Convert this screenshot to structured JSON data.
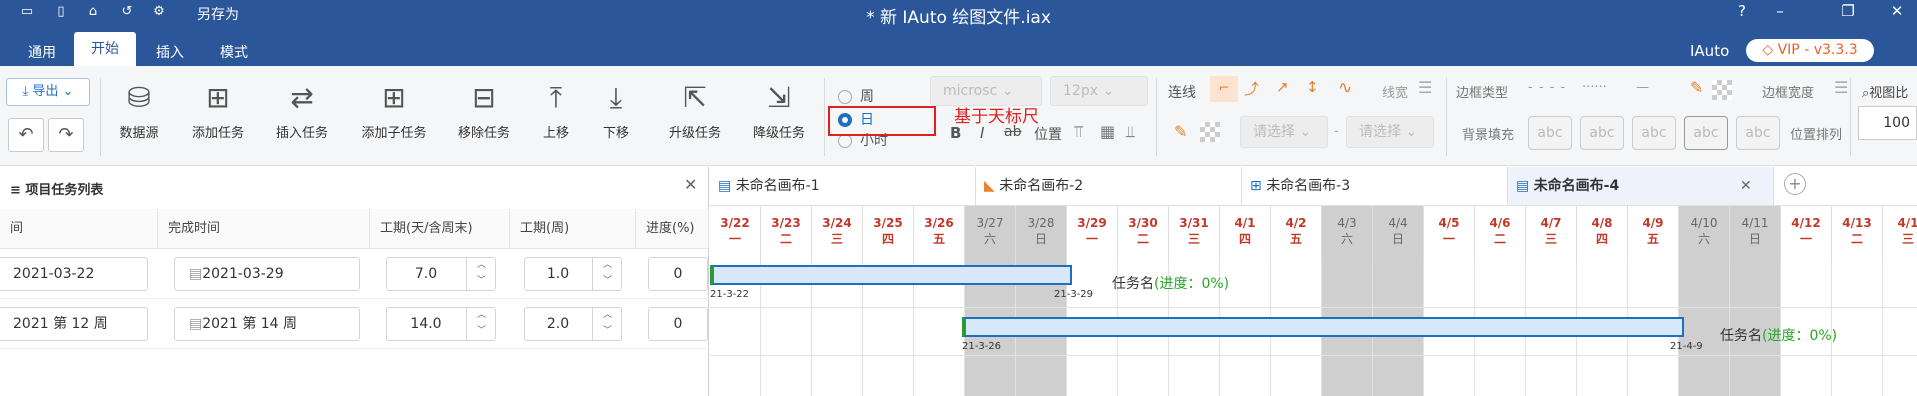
{
  "titlebar": {
    "save_as": "另存为",
    "title": "* 新 IAuto 绘图文件.iax",
    "help": "?",
    "minimize": "–",
    "restore": "❐",
    "close": "✕"
  },
  "menu": {
    "tabs": [
      "通用",
      "开始",
      "插入",
      "模式"
    ],
    "active": "开始",
    "brand": "IAuto",
    "vip": "VIP - v3.3.3"
  },
  "ribbon": {
    "export": "导出",
    "buttons": [
      "数据源",
      "添加任务",
      "插入任务",
      "添加子任务",
      "移除任务",
      "上移",
      "下移",
      "升级任务",
      "降级任务"
    ],
    "scale": {
      "week": "周",
      "day": "日",
      "hour": "小时",
      "selected": "日"
    },
    "annotation": "基于天标尺",
    "font_name": "microsc",
    "font_size": "12px",
    "format_buttons": [
      "B",
      "I",
      "ab",
      "位置"
    ],
    "line_label": "连线",
    "line_width_label": "线宽",
    "border_type_label": "边框类型",
    "border_width_label": "边框宽度",
    "view_label": "视图比",
    "zoom": "100",
    "select_placeholder": "请选择",
    "dash": "-",
    "bg_fill_label": "背景填充",
    "abc": "abc",
    "position_arrange_label": "位置排列"
  },
  "leftpanel": {
    "title": "≡ 项目任务列表",
    "columns": [
      "间",
      "完成时间",
      "工期(天/含周末)",
      "工期(周)",
      "进度(%)"
    ],
    "rows": [
      {
        "start": "2021-03-22",
        "end": "2021-03-29",
        "days": "7.0",
        "weeks": "1.0",
        "progress": "0"
      },
      {
        "start": "2021 第 12 周",
        "end": "2021 第 14 周",
        "days": "14.0",
        "weeks": "2.0",
        "progress": "0"
      }
    ]
  },
  "canvas": {
    "tabs": [
      "未命名画布-1",
      "未命名画布-2",
      "未命名画布-3",
      "未命名画布-4"
    ],
    "active_tab": "未命名画布-4",
    "days": [
      {
        "d": "3/22",
        "w": "一"
      },
      {
        "d": "3/23",
        "w": "二"
      },
      {
        "d": "3/24",
        "w": "三"
      },
      {
        "d": "3/25",
        "w": "四"
      },
      {
        "d": "3/26",
        "w": "五"
      },
      {
        "d": "3/27",
        "w": "六"
      },
      {
        "d": "3/28",
        "w": "日"
      },
      {
        "d": "3/29",
        "w": "一"
      },
      {
        "d": "3/30",
        "w": "二"
      },
      {
        "d": "3/31",
        "w": "三"
      },
      {
        "d": "4/1",
        "w": "四"
      },
      {
        "d": "4/2",
        "w": "五"
      },
      {
        "d": "4/3",
        "w": "六"
      },
      {
        "d": "4/4",
        "w": "日"
      },
      {
        "d": "4/5",
        "w": "一"
      },
      {
        "d": "4/6",
        "w": "二"
      },
      {
        "d": "4/7",
        "w": "三"
      },
      {
        "d": "4/8",
        "w": "四"
      },
      {
        "d": "4/9",
        "w": "五"
      },
      {
        "d": "4/10",
        "w": "六"
      },
      {
        "d": "4/11",
        "w": "日"
      },
      {
        "d": "4/12",
        "w": "一"
      },
      {
        "d": "4/13",
        "w": "二"
      },
      {
        "d": "4/1",
        "w": "三"
      }
    ],
    "tasks": [
      {
        "start_label": "21-3-22",
        "end_label": "21-3-29",
        "name": "任务名",
        "progress": "(进度：0%)"
      },
      {
        "start_label": "21-3-26",
        "end_label": "21-4-9",
        "name": "任务名",
        "progress": "(进度：0%)"
      }
    ]
  }
}
